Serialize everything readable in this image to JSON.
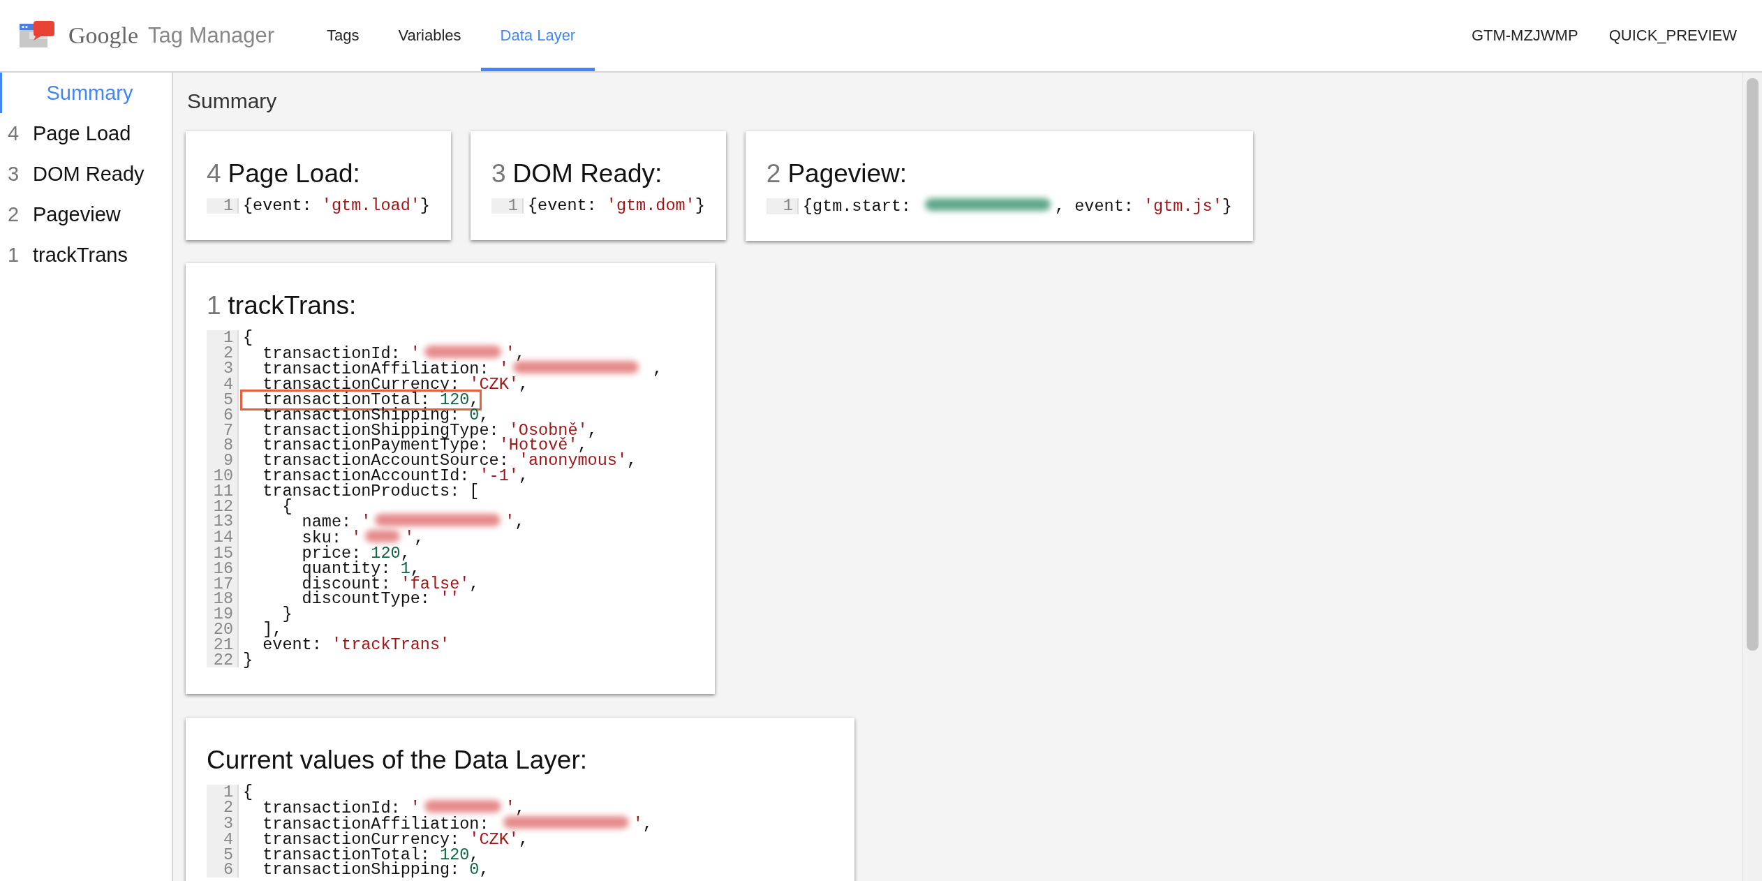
{
  "header": {
    "logo": {
      "brand": "Google",
      "product": "Tag Manager"
    },
    "tabs": [
      {
        "label": "Tags",
        "selected": false
      },
      {
        "label": "Variables",
        "selected": false
      },
      {
        "label": "Data Layer",
        "selected": true
      }
    ],
    "right_items": [
      "GTM-MZJWMP",
      "QUICK_PREVIEW"
    ]
  },
  "sidebar": {
    "items": [
      {
        "label": "Summary",
        "selected": true
      },
      {
        "number": "4",
        "label": "Page Load",
        "selected": false
      },
      {
        "number": "3",
        "label": "DOM Ready",
        "selected": false
      },
      {
        "number": "2",
        "label": "Pageview",
        "selected": false
      },
      {
        "number": "1",
        "label": "trackTrans",
        "selected": false
      }
    ]
  },
  "main": {
    "heading": "Summary",
    "event_cards": [
      {
        "number": "4",
        "title": "Page Load:",
        "code": [
          {
            "line": "1",
            "segments": [
              {
                "kind": "plain",
                "text": "{event: "
              },
              {
                "kind": "string",
                "text": "'gtm.load'"
              },
              {
                "kind": "plain",
                "text": "}"
              }
            ]
          }
        ]
      },
      {
        "number": "3",
        "title": "DOM Ready:",
        "code": [
          {
            "line": "1",
            "segments": [
              {
                "kind": "plain",
                "text": "{event: "
              },
              {
                "kind": "string",
                "text": "'gtm.dom'"
              },
              {
                "kind": "plain",
                "text": "}"
              }
            ]
          }
        ]
      },
      {
        "number": "2",
        "title": "Pageview:",
        "code": [
          {
            "line": "1",
            "segments": [
              {
                "kind": "plain",
                "text": "{gtm.start: "
              },
              {
                "kind": "redacted_number"
              },
              {
                "kind": "plain",
                "text": ", event: "
              },
              {
                "kind": "string",
                "text": "'gtm.js'"
              },
              {
                "kind": "plain",
                "text": "}"
              }
            ]
          }
        ]
      },
      {
        "number": "1",
        "title": "trackTrans:",
        "code": [
          {
            "line": "1",
            "segments": [
              {
                "kind": "plain",
                "text": "{"
              }
            ]
          },
          {
            "line": "2",
            "segments": [
              {
                "kind": "plain",
                "text": "  transactionId: "
              },
              {
                "kind": "string",
                "text": "'"
              },
              {
                "kind": "redacted_medium"
              },
              {
                "kind": "string",
                "text": "'"
              },
              {
                "kind": "plain",
                "text": ","
              }
            ]
          },
          {
            "line": "3",
            "segments": [
              {
                "kind": "plain",
                "text": "  transactionAffiliation: "
              },
              {
                "kind": "string",
                "text": "'"
              },
              {
                "kind": "redacted_long"
              },
              {
                "kind": "plain",
                "text": " ,"
              }
            ]
          },
          {
            "line": "4",
            "segments": [
              {
                "kind": "plain",
                "text": "  transactionCurrency: "
              },
              {
                "kind": "string",
                "text": "'CZK'"
              },
              {
                "kind": "plain",
                "text": ","
              }
            ]
          },
          {
            "line": "5",
            "highlighted": true,
            "segments": [
              {
                "kind": "plain",
                "text": "  transactionTotal: "
              },
              {
                "kind": "number",
                "text": "120"
              },
              {
                "kind": "plain",
                "text": ","
              }
            ]
          },
          {
            "line": "6",
            "segments": [
              {
                "kind": "plain",
                "text": "  transactionShipping: "
              },
              {
                "kind": "number",
                "text": "0"
              },
              {
                "kind": "plain",
                "text": ","
              }
            ]
          },
          {
            "line": "7",
            "segments": [
              {
                "kind": "plain",
                "text": "  transactionShippingType: "
              },
              {
                "kind": "string",
                "text": "'Osobně'"
              },
              {
                "kind": "plain",
                "text": ","
              }
            ]
          },
          {
            "line": "8",
            "segments": [
              {
                "kind": "plain",
                "text": "  transactionPaymentType: "
              },
              {
                "kind": "string",
                "text": "'Hotově'"
              },
              {
                "kind": "plain",
                "text": ","
              }
            ]
          },
          {
            "line": "9",
            "segments": [
              {
                "kind": "plain",
                "text": "  transactionAccountSource: "
              },
              {
                "kind": "string",
                "text": "'anonymous'"
              },
              {
                "kind": "plain",
                "text": ","
              }
            ]
          },
          {
            "line": "10",
            "segments": [
              {
                "kind": "plain",
                "text": "  transactionAccountId: "
              },
              {
                "kind": "string",
                "text": "'-1'"
              },
              {
                "kind": "plain",
                "text": ","
              }
            ]
          },
          {
            "line": "11",
            "segments": [
              {
                "kind": "plain",
                "text": "  transactionProducts: ["
              }
            ]
          },
          {
            "line": "12",
            "segments": [
              {
                "kind": "plain",
                "text": "    {"
              }
            ]
          },
          {
            "line": "13",
            "segments": [
              {
                "kind": "plain",
                "text": "      name: "
              },
              {
                "kind": "string",
                "text": "'"
              },
              {
                "kind": "redacted_long"
              },
              {
                "kind": "string",
                "text": "'"
              },
              {
                "kind": "plain",
                "text": ","
              }
            ]
          },
          {
            "line": "14",
            "segments": [
              {
                "kind": "plain",
                "text": "      sku: "
              },
              {
                "kind": "string",
                "text": "'"
              },
              {
                "kind": "redacted_short"
              },
              {
                "kind": "string",
                "text": "'"
              },
              {
                "kind": "plain",
                "text": ","
              }
            ]
          },
          {
            "line": "15",
            "segments": [
              {
                "kind": "plain",
                "text": "      price: "
              },
              {
                "kind": "number",
                "text": "120"
              },
              {
                "kind": "plain",
                "text": ","
              }
            ]
          },
          {
            "line": "16",
            "segments": [
              {
                "kind": "plain",
                "text": "      quantity: "
              },
              {
                "kind": "number",
                "text": "1"
              },
              {
                "kind": "plain",
                "text": ","
              }
            ]
          },
          {
            "line": "17",
            "segments": [
              {
                "kind": "plain",
                "text": "      discount: "
              },
              {
                "kind": "string",
                "text": "'false'"
              },
              {
                "kind": "plain",
                "text": ","
              }
            ]
          },
          {
            "line": "18",
            "segments": [
              {
                "kind": "plain",
                "text": "      discountType: "
              },
              {
                "kind": "string",
                "text": "''"
              }
            ]
          },
          {
            "line": "19",
            "segments": [
              {
                "kind": "plain",
                "text": "    }"
              }
            ]
          },
          {
            "line": "20",
            "segments": [
              {
                "kind": "plain",
                "text": "  ],"
              }
            ]
          },
          {
            "line": "21",
            "segments": [
              {
                "kind": "plain",
                "text": "  event: "
              },
              {
                "kind": "string",
                "text": "'trackTrans'"
              }
            ]
          },
          {
            "line": "22",
            "segments": [
              {
                "kind": "plain",
                "text": "}"
              }
            ]
          }
        ]
      }
    ],
    "current_values": {
      "title": "Current values of the Data Layer:",
      "code": [
        {
          "line": "1",
          "segments": [
            {
              "kind": "plain",
              "text": "{"
            }
          ]
        },
        {
          "line": "2",
          "segments": [
            {
              "kind": "plain",
              "text": "  transactionId: "
            },
            {
              "kind": "string",
              "text": "'"
            },
            {
              "kind": "redacted_medium"
            },
            {
              "kind": "string",
              "text": "'"
            },
            {
              "kind": "plain",
              "text": ","
            }
          ]
        },
        {
          "line": "3",
          "segments": [
            {
              "kind": "plain",
              "text": "  transactionAffiliation: "
            },
            {
              "kind": "redacted_long"
            },
            {
              "kind": "string",
              "text": "'"
            },
            {
              "kind": "plain",
              "text": ","
            }
          ]
        },
        {
          "line": "4",
          "segments": [
            {
              "kind": "plain",
              "text": "  transactionCurrency: "
            },
            {
              "kind": "string",
              "text": "'CZK'"
            },
            {
              "kind": "plain",
              "text": ","
            }
          ]
        },
        {
          "line": "5",
          "segments": [
            {
              "kind": "plain",
              "text": "  transactionTotal: "
            },
            {
              "kind": "number",
              "text": "120"
            },
            {
              "kind": "plain",
              "text": ","
            }
          ]
        },
        {
          "line": "6",
          "segments": [
            {
              "kind": "plain",
              "text": "  transactionShipping: "
            },
            {
              "kind": "number",
              "text": "0"
            },
            {
              "kind": "plain",
              "text": ","
            }
          ]
        }
      ]
    }
  }
}
